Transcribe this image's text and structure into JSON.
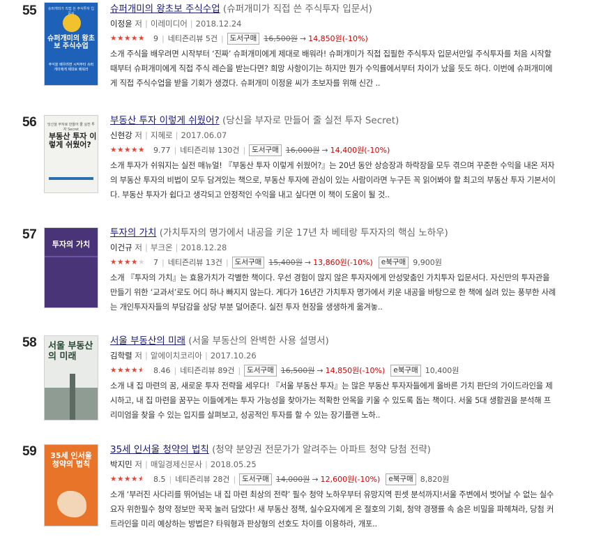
{
  "books": [
    {
      "rank": "55",
      "title": "슈퍼개미의 왕초보 주식수업",
      "subtitle": "(슈퍼개미가 직접 쓴 주식투자 입문서)",
      "author": "이정윤",
      "author_suffix": "저",
      "publisher": "이레미디어",
      "date": "2018.12.24",
      "rating": 4.5,
      "score": "9",
      "review_label": "네티즌리뷰 5건",
      "paper_button": "도서구매",
      "orig_price": "16,500원",
      "arrow": "→",
      "sale_price": "14,850원(-10%)",
      "ebook_button": "",
      "ebook_price": "",
      "description": "소개  주식을 배우려면 시작부터 ‘진짜’ 슈퍼개미에게 제대로 배워라! 슈퍼개미가 직접 집필한 주식투자 입문서만일 주식투자를 처음 시작할 때부터 슈퍼개미에게 직접 주식 레슨을 받는다면? 희망 사항이기는 하지만 뭔가 수익률에서부터 차이가 났을 듯도 하다. 이번에 슈퍼개미에게 직접 주식수업을 받을 기회가 생겼다. 슈퍼개미 이정윤 씨가 초보자를 위해 신간 ..",
      "cover": {
        "title": "슈퍼개미의 왕초보 주식수업",
        "top_text": "슈퍼개미가 직접 쓴 주식투자 입문서",
        "tagline": "주식을 배우려면 시작부터 슈퍼개미에게 제대로 배워라",
        "bg": "#1d62b8",
        "title_color": "#ffffff",
        "accent": "#f2c12e"
      }
    },
    {
      "rank": "56",
      "title": "부동산 투자 이렇게 쉬웠어?",
      "subtitle": "(당신을 부자로 만들어 줄 실전 투자 Secret)",
      "author": "신현강",
      "author_suffix": "저",
      "publisher": "지혜로",
      "date": "2017.06.07",
      "rating": 5,
      "score": "9.77",
      "review_label": "네티즌리뷰 130건",
      "paper_button": "도서구매",
      "orig_price": "16,000원",
      "arrow": "→",
      "sale_price": "14,400원(-10%)",
      "ebook_button": "",
      "ebook_price": "",
      "description": "소개  투자가 쉬워지는 실전 매뉴얼! 『부동산 투자 이렇게 쉬웠어?』는 20년 동안 상승장과 하락장을 모두 겪으며 꾸준한 수익을 내온 저자의 부동산 투자의 비법이 모두 담겨있는 책으로, 부동산 투자에 관심이 있는 사람이라면 누구든 꼭 읽어봐야 할 최고의 부동산 투자 기본서이다. 부동산 투자가 쉽다고 생각되고 안정적인 수익을 내고 싶다면 이 책이 도움이 될 것..",
      "cover": {
        "title": "부동산 투자 이렇게 쉬웠어?",
        "top_text": "당신을 부자로 만들어 줄 실전 투자 Secret",
        "tagline": "",
        "bg": "#f2f2ee",
        "title_color": "#222222",
        "accent": "#2a6fb3"
      }
    },
    {
      "rank": "57",
      "title": "투자의 가치",
      "subtitle": "(가치투자의 명가에서 내공을 키운 17년 차 베테랑 투자자의 핵심 노하우)",
      "author": "이건규",
      "author_suffix": "저",
      "publisher": "부크온",
      "date": "2018.12.28",
      "rating": 3.5,
      "score": "7",
      "review_label": "네티즌리뷰 13건",
      "paper_button": "도서구매",
      "orig_price": "15,400원",
      "arrow": "→",
      "sale_price": "13,860원(-10%)",
      "ebook_button": "e북구매",
      "ebook_price": "9,900원",
      "description": "소개  『투자의 가치』는 효용가치가 각별한 책이다. 우선 경험이 많지 않은 투자자에게 안성맞춤인 가치투자 입문서다. 자신만의 투자관을 만들기 위한 ‘교과서’로도 어디 하나 빠지지 않는다. 게다가 16년간 가치투자 명가에서 키운 내공을 바탕으로 한 책에 실려 있는 풍부한 사례는 개인투자자들의 부담감을 상당 부분 덜어준다. 실전 투자 현장을 생생하게 옮겨놓..",
      "cover": {
        "title": "투자의 가치",
        "top_text": "",
        "tagline": "",
        "bg": "#4a3478",
        "title_color": "#ffffff",
        "accent": "#6b52a0"
      }
    },
    {
      "rank": "58",
      "title": "서울 부동산의 미래",
      "subtitle": "(서울 부동산의 완벽한 사용 설명서)",
      "author": "김학렬",
      "author_suffix": "저",
      "publisher": "알에이치코리아",
      "date": "2017.10.26",
      "rating": 4,
      "score": "8.46",
      "review_label": "네티즌리뷰 89건",
      "paper_button": "도서구매",
      "orig_price": "16,500원",
      "arrow": "→",
      "sale_price": "14,850원(-10%)",
      "ebook_button": "e북구매",
      "ebook_price": "10,400원",
      "description": "소개  내 집 마련의 꿈, 새로운 투자 전략을 세우다! 『서울 부동산 투자』는 많은 부동산 투자자들에게 올바른 가치 판단의 가이드라인을 제시하고, 내 집 마련을 꿈꾸는 이들에게는 투자 가능성을 찾아가는 적확한 안목을 키울 수 있도록 돕는 책이다. 서울 5대 생활권을 분석해 프리미엄을 찾을 수 있는 입지를 살펴보고, 성공적인 투자를 할 수 있는 장기플랜 노하..",
      "cover": {
        "title": "서울 부동산의 미래",
        "top_text": "",
        "tagline": "",
        "bg": "#e9ebe8",
        "title_color": "#2a4733",
        "accent": "#4f7a5a"
      }
    },
    {
      "rank": "59",
      "title": "35세 인서울 청약의 법칙",
      "subtitle": "(청약 분양권 전문가가 알려주는 아파트 청약 당첨 전략)",
      "author": "박지민",
      "author_suffix": "저",
      "publisher": "매일경제신문사",
      "date": "2018.05.25",
      "rating": 4,
      "score": "8.5",
      "review_label": "네티즌리뷰 28건",
      "paper_button": "도서구매",
      "orig_price": "14,000원",
      "arrow": "→",
      "sale_price": "12,600원(-10%)",
      "ebook_button": "e북구매",
      "ebook_price": "8,820원",
      "description": "소개  ‘부러진 사다리를 뛰어넘는 내 집 마련 최상의 전략’ 필수 청약 노하우부터 유망지역 핀셋 분석까지!서울 주변에서 벗어날 수 없는 실수요자 위한필수 청약 정보만 꾹꾹 눌러 담았다! 새 부동산 정책, 실수요자에게 온 절호의 기회, 청약 경쟁률 속 숨은 비밀을 파헤쳐라, 당첨 커트라인을 미리 예상하는 방법은? 타워형과 판상형의 선호도 차이를 이용하라, 개포..",
      "cover": {
        "title": "35세 인서울 청약의 법칙",
        "top_text": "",
        "tagline": "",
        "bg": "#e8742a",
        "title_color": "#ffffff",
        "accent": "#f3d6b8"
      }
    }
  ],
  "colors": {
    "title_link": "#1a1a7a",
    "sale": "#d40000",
    "star": "#e9402f"
  }
}
